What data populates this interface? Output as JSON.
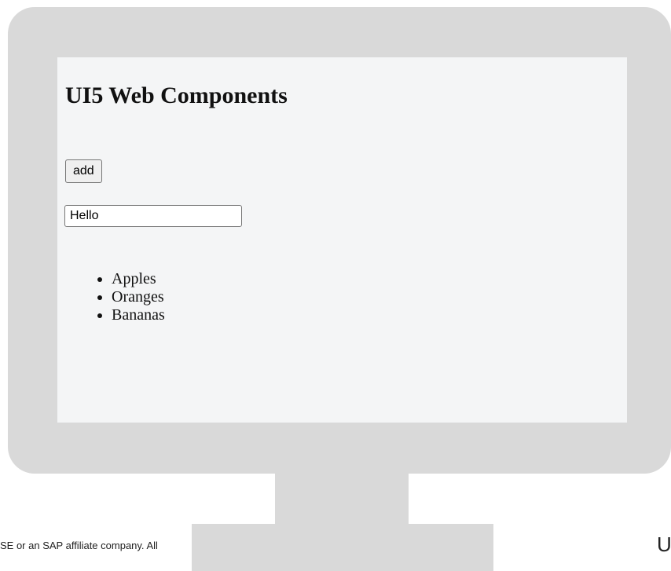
{
  "screen": {
    "heading": "UI5 Web Components",
    "add_button_label": "add",
    "input_value": "Hello",
    "list_items": [
      "Apples",
      "Oranges",
      "Bananas"
    ]
  },
  "footer": {
    "copyright_fragment": "SE or an SAP affiliate company. All",
    "right_fragment": "U"
  },
  "colors": {
    "monitor_frame": "#d9d9d9",
    "screen_background": "#f4f5f6"
  }
}
